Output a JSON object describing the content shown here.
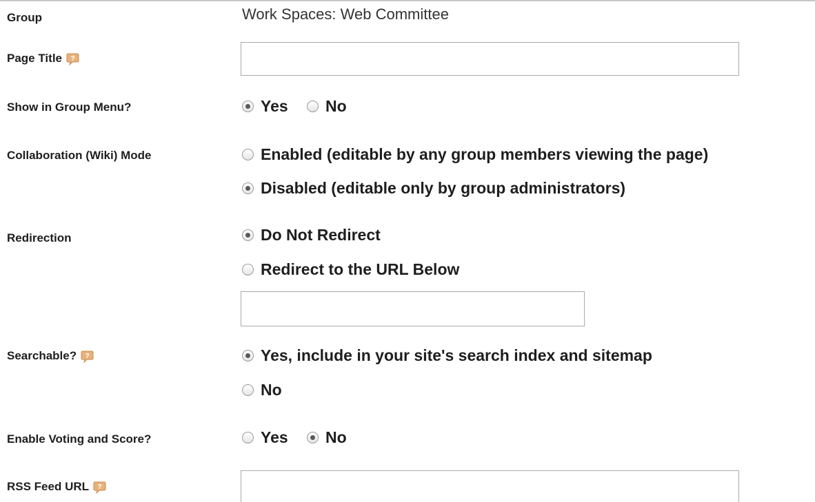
{
  "group": {
    "label": "Group",
    "value": "Work Spaces: Web Committee"
  },
  "page_title": {
    "label": "Page Title",
    "value": "",
    "help_icon": "help-icon"
  },
  "show_in_menu": {
    "label": "Show in Group Menu?",
    "options": [
      {
        "label": "Yes",
        "checked": true
      },
      {
        "label": "No",
        "checked": false
      }
    ]
  },
  "wiki_mode": {
    "label": "Collaboration (Wiki) Mode",
    "options": [
      {
        "label": "Enabled (editable by any group members viewing the page)",
        "checked": false
      },
      {
        "label": "Disabled (editable only by group administrators)",
        "checked": true
      }
    ]
  },
  "redirection": {
    "label": "Redirection",
    "options": [
      {
        "label": "Do Not Redirect",
        "checked": true
      },
      {
        "label": "Redirect to the URL Below",
        "checked": false
      }
    ],
    "url_value": ""
  },
  "searchable": {
    "label": "Searchable?",
    "help_icon": "help-icon",
    "options": [
      {
        "label": "Yes, include in your site's search index and sitemap",
        "checked": true
      },
      {
        "label": "No",
        "checked": false
      }
    ]
  },
  "voting": {
    "label": "Enable Voting and Score?",
    "options": [
      {
        "label": "Yes",
        "checked": false
      },
      {
        "label": "No",
        "checked": true
      }
    ]
  },
  "rss_feed": {
    "label": "RSS Feed URL",
    "help_icon": "help-icon",
    "value": ""
  },
  "colors": {
    "help_icon_fill": "#e8b27c",
    "help_icon_stroke": "#c98a4e",
    "input_border": "#a9a9a9"
  }
}
